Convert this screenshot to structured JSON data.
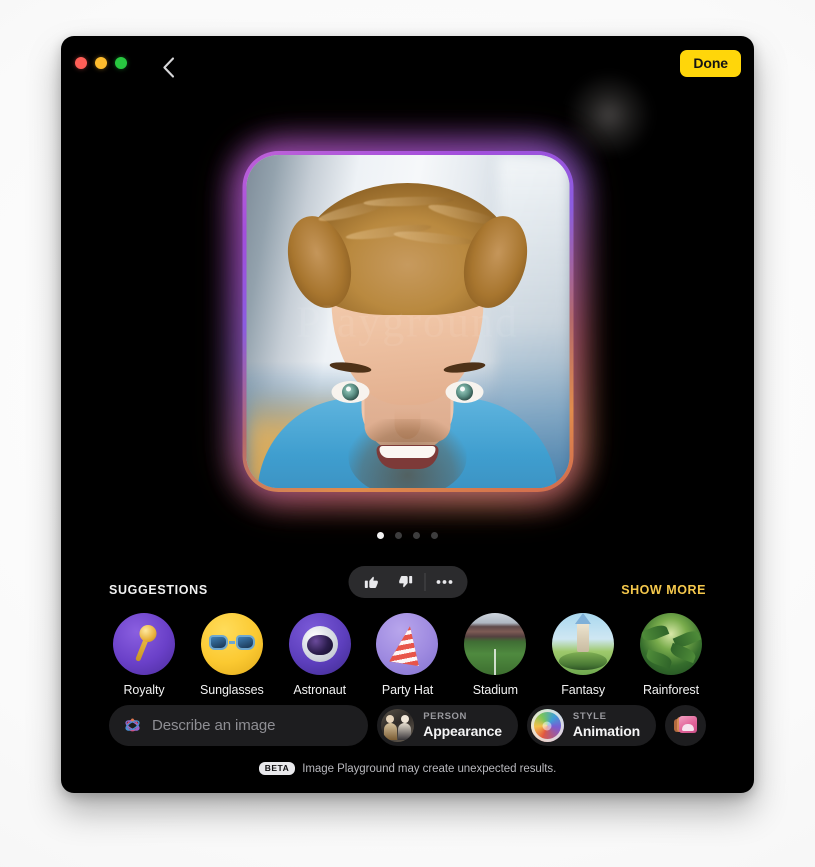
{
  "window": {
    "traffic_lights": [
      "close",
      "minimize",
      "maximize"
    ],
    "back_label": "Back",
    "done_label": "Done"
  },
  "hero": {
    "alt": "AI generated animation style portrait of a man with wavy blond hair in a blue shirt",
    "watermark": "Playground",
    "pager": {
      "total": 4,
      "active_index": 0
    }
  },
  "feedback": {
    "thumbs_up_label": "Like",
    "thumbs_down_label": "Dislike",
    "more_label": "More options"
  },
  "suggestions": {
    "title": "SUGGESTIONS",
    "show_more": "SHOW MORE",
    "items": [
      {
        "label": "Royalty",
        "icon": "scepter-icon"
      },
      {
        "label": "Sunglasses",
        "icon": "sunglasses-icon"
      },
      {
        "label": "Astronaut",
        "icon": "astronaut-helmet-icon"
      },
      {
        "label": "Party Hat",
        "icon": "party-hat-icon"
      },
      {
        "label": "Stadium",
        "icon": "stadium-icon"
      },
      {
        "label": "Fantasy",
        "icon": "castle-icon"
      },
      {
        "label": "Rainforest",
        "icon": "rainforest-icon"
      }
    ]
  },
  "composer": {
    "describe_placeholder": "Describe an image",
    "describe_value": "",
    "sparkle_icon": "playground-sparkle-icon",
    "person_chip": {
      "kicker": "PERSON",
      "value": "Appearance",
      "icon": "person-photo-icon"
    },
    "style_chip": {
      "kicker": "STYLE",
      "value": "Animation",
      "icon": "style-color-wheel-icon"
    },
    "photo_button": {
      "label": "Choose photo",
      "icon": "photos-library-icon"
    }
  },
  "footer": {
    "badge": "BETA",
    "text": "Image Playground may create unexpected results."
  },
  "colors": {
    "accent_yellow": "#ffd60a",
    "show_more_gold": "#f5c84c",
    "window_bg": "#000000",
    "control_bg": "#1d1d1f"
  }
}
